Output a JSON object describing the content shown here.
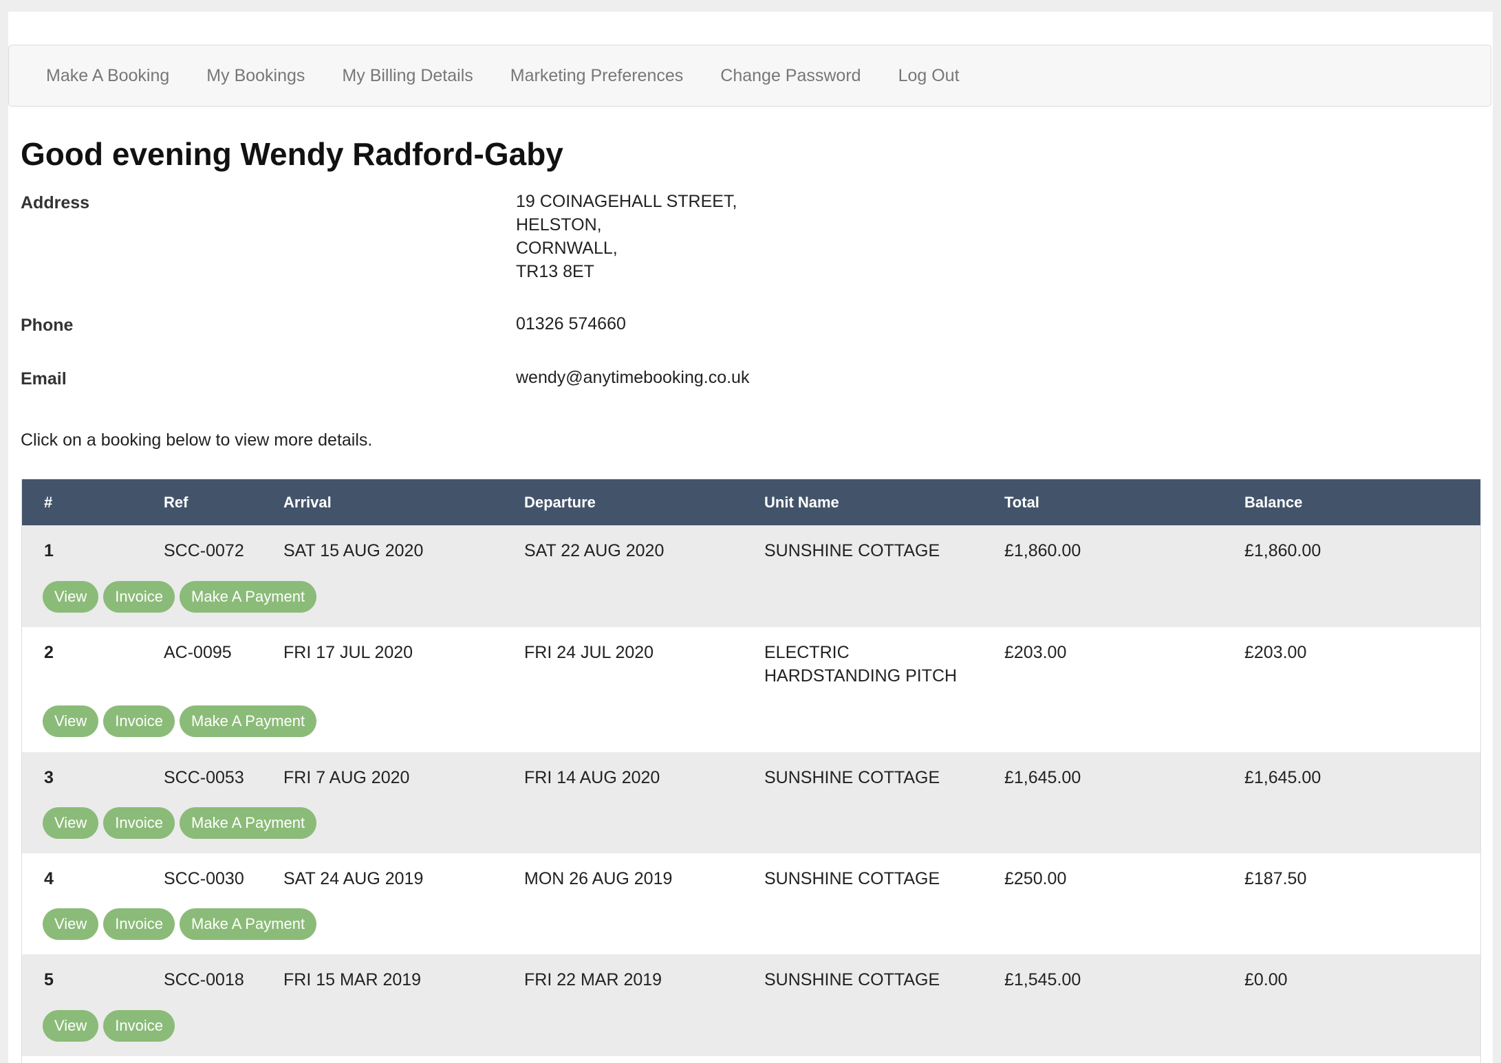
{
  "nav": {
    "items": [
      "Make A Booking",
      "My Bookings",
      "My Billing Details",
      "Marketing Preferences",
      "Change Password",
      "Log Out"
    ]
  },
  "greeting": "Good evening Wendy Radford-Gaby",
  "customer": {
    "address_label": "Address",
    "address_lines": [
      "19 COINAGEHALL STREET,",
      "HELSTON,",
      "CORNWALL,",
      "TR13 8ET"
    ],
    "phone_label": "Phone",
    "phone": "01326 574660",
    "email_label": "Email",
    "email": "wendy@anytimebooking.co.uk"
  },
  "hint": "Click on a booking below to view more details.",
  "table": {
    "headers": {
      "num": "#",
      "ref": "Ref",
      "arrival": "Arrival",
      "departure": "Departure",
      "unit": "Unit Name",
      "total": "Total",
      "balance": "Balance"
    },
    "button_labels": {
      "view": "View",
      "invoice": "Invoice",
      "pay": "Make A Payment"
    },
    "rows": [
      {
        "num": "1",
        "ref": "SCC-0072",
        "arrival": "SAT 15 AUG 2020",
        "departure": "SAT 22 AUG 2020",
        "unit": "SUNSHINE COTTAGE",
        "total": "£1,860.00",
        "balance": "£1,860.00",
        "show_pay": true
      },
      {
        "num": "2",
        "ref": "AC-0095",
        "arrival": "FRI 17 JUL 2020",
        "departure": "FRI 24 JUL 2020",
        "unit": "ELECTRIC HARDSTANDING PITCH",
        "total": "£203.00",
        "balance": "£203.00",
        "show_pay": true
      },
      {
        "num": "3",
        "ref": "SCC-0053",
        "arrival": "FRI 7 AUG 2020",
        "departure": "FRI 14 AUG 2020",
        "unit": "SUNSHINE COTTAGE",
        "total": "£1,645.00",
        "balance": "£1,645.00",
        "show_pay": true
      },
      {
        "num": "4",
        "ref": "SCC-0030",
        "arrival": "SAT 24 AUG 2019",
        "departure": "MON 26 AUG 2019",
        "unit": "SUNSHINE COTTAGE",
        "total": "£250.00",
        "balance": "£187.50",
        "show_pay": true
      },
      {
        "num": "5",
        "ref": "SCC-0018",
        "arrival": "FRI 15 MAR 2019",
        "departure": "FRI 22 MAR 2019",
        "unit": "SUNSHINE COTTAGE",
        "total": "£1,545.00",
        "balance": "£0.00",
        "show_pay": false
      }
    ]
  }
}
